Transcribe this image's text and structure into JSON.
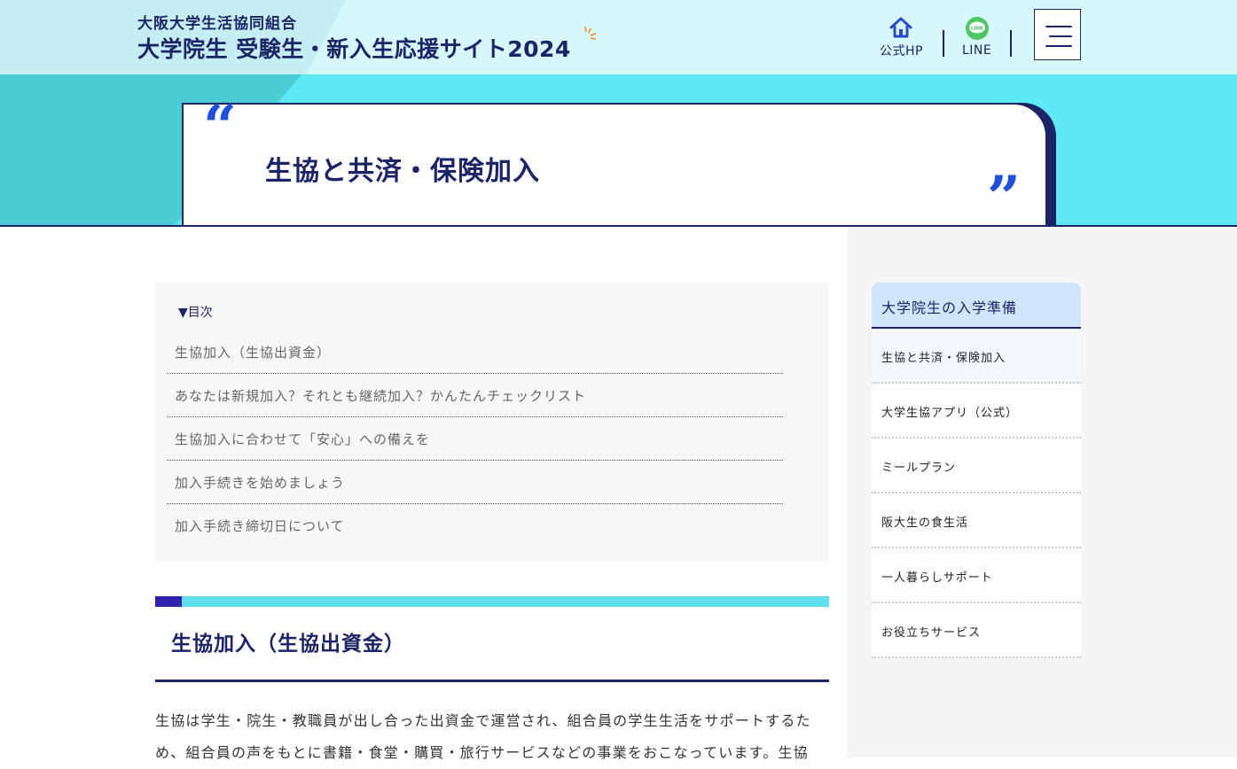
{
  "header": {
    "org_name": "大阪大学生活協同組合",
    "site_title": "大学院生 受験生・新入生応援サイト2024",
    "official_hp_label": "公式HP",
    "line_label": "LINE",
    "line_icon_text": "LINE",
    "icons": {
      "home": "home-icon",
      "line": "line-icon",
      "menu": "hamburger-menu-icon"
    }
  },
  "hero": {
    "quote_open": "“",
    "quote_close": "”",
    "title": "生協と共済・保険加入"
  },
  "toc": {
    "heading": "▼目次",
    "items": [
      "生協加入（生協出資金）",
      "あなたは新規加入？それとも継続加入？かんたんチェックリスト",
      "生協加入に合わせて「安心」への備えを",
      "加入手続きを始めましょう",
      "加入手続き締切日について"
    ]
  },
  "section": {
    "title": "生協加入（生協出資金）",
    "body": "生協は学生・院生・教職員が出し合った出資金で運営され、組合員の学生生活をサポートするため、組合員の声をもとに書籍・食堂・購買・旅行サービスなどの事業をおこなっています。生協"
  },
  "sidebar": {
    "heading": "大学院生の入学準備",
    "items": [
      "生協と共済・保険加入",
      "大学生協アプリ（公式）",
      "ミールプラン",
      "阪大生の食生活",
      "一人暮らしサポート",
      "お役立ちサービス"
    ]
  },
  "colors": {
    "navy": "#1a2466",
    "header_bg": "#d2f6fa",
    "hero_bg": "#5eeaf4",
    "quote_blue": "#1e4fe0",
    "line_green": "#4cc764",
    "accent_purple": "#3020b0",
    "sidebar_head_bg": "#cfe6fb"
  }
}
